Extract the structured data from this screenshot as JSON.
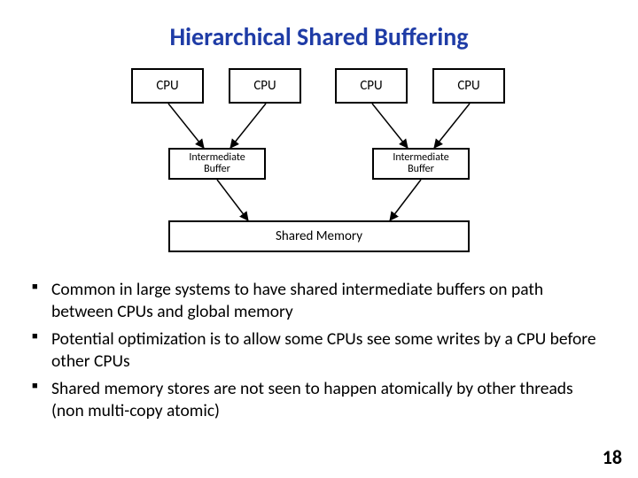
{
  "title": "Hierarchical Shared Buffering",
  "cpu_label": "CPU",
  "buffer_label": "Intermediate\nBuffer",
  "memory_label": "Shared Memory",
  "bullets": [
    "Common in large systems to have shared intermediate buffers on path between CPUs and global memory",
    "Potential optimization is to allow some CPUs see some writes by a CPU before other CPUs",
    "Shared memory stores are not seen to happen atomically by other threads (non multi-copy atomic)"
  ],
  "page_number": "18"
}
